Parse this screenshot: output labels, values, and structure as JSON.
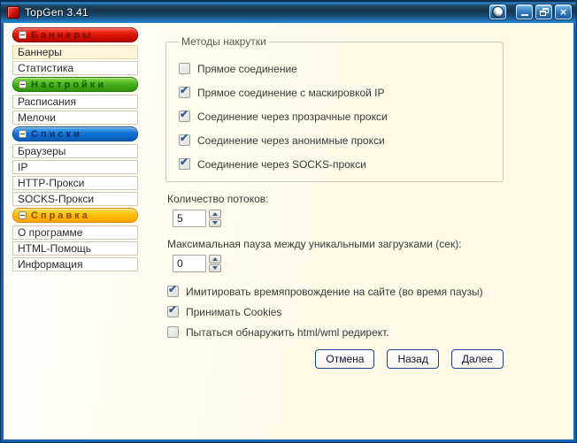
{
  "window": {
    "title": "TopGen 3.41",
    "controls": {
      "globe": "globe",
      "minimize": "minimize",
      "restore": "restore",
      "close": "close"
    }
  },
  "colors": {
    "frame_blue": "#1263b2",
    "banners_red": "#e01505",
    "settings_green": "#47b21c",
    "lists_blue": "#1173d6",
    "help_yellow": "#ffbe0c",
    "check_mark": "#3c5d92",
    "content_cream": "#fffae6"
  },
  "sidebar": {
    "groups": [
      {
        "label": "Баннеры",
        "items": [
          "Баннеры",
          "Статистика"
        ]
      },
      {
        "label": "Настройки",
        "items": [
          "Расписания",
          "Мелочи"
        ]
      },
      {
        "label": "Списки",
        "items": [
          "Браузеры",
          "IP",
          "HTTP-Прокси",
          "SOCKS-Прокси"
        ]
      },
      {
        "label": "Справка",
        "items": [
          "О программе",
          "HTML-Помощь",
          "Информация"
        ]
      }
    ],
    "active_item": "Баннеры"
  },
  "main": {
    "methods_group": {
      "title": "Методы накрутки",
      "checkboxes": [
        {
          "label": "Прямое соединение",
          "checked": false
        },
        {
          "label": "Прямое соединение с маскировкой IP",
          "checked": true
        },
        {
          "label": "Соединение через прозрачные прокси",
          "checked": true
        },
        {
          "label": "Соединение через анонимные прокси",
          "checked": true
        },
        {
          "label": "Соединение через SOCKS-прокси",
          "checked": true
        }
      ]
    },
    "threads": {
      "label": "Количество потоков:",
      "value": "5"
    },
    "max_pause": {
      "label": "Максимальная пауза между уникальными загрузками (сек):",
      "value": "0"
    },
    "options": [
      {
        "label": "Имитировать времяпровождение на сайте (во время паузы)",
        "checked": true
      },
      {
        "label": "Принимать Cookies",
        "checked": true
      },
      {
        "label": "Пытаться обнаружить html/wml редирект.",
        "checked": false
      }
    ],
    "buttons": {
      "cancel": "Отмена",
      "back": "Назад",
      "next": "Далее"
    }
  }
}
